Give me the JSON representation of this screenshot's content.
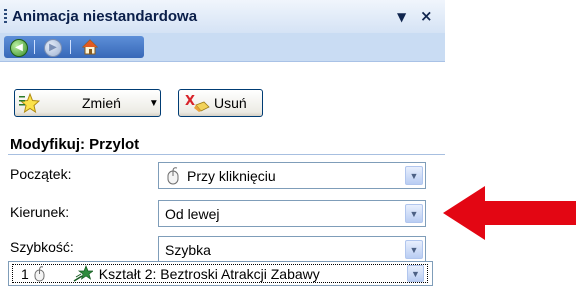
{
  "pane": {
    "title": "Animacja niestandardowa",
    "menu_glyph": "▼",
    "close_glyph": "×"
  },
  "toolbar": {
    "change_label": "Zmień",
    "delete_label": "Usuń"
  },
  "modify": {
    "heading": "Modyfikuj: Przylot",
    "start_label": "Początek:",
    "start_value": "Przy kliknięciu",
    "direction_label": "Kierunek:",
    "direction_value": "Od lewej",
    "speed_label": "Szybkość:",
    "speed_value": "Szybka"
  },
  "animation_list": {
    "items": [
      {
        "number": "1",
        "text": "Kształt 2: Beztroski Atrakcji Zabawy"
      }
    ]
  },
  "colors": {
    "pane_bg": "#dbe8f8",
    "title_text": "#0b1f4a",
    "annotation_arrow": "#e30613"
  },
  "icons": [
    "back-icon",
    "forward-icon",
    "home-icon",
    "star-add-icon",
    "delete-x-icon",
    "mouse-click-icon",
    "fly-in-effect-icon",
    "chevron-down-icon",
    "red-arrow"
  ]
}
